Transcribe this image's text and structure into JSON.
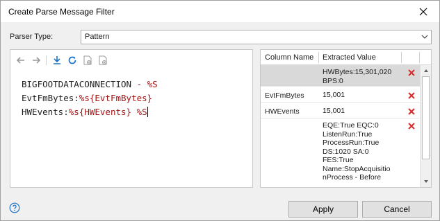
{
  "window": {
    "title": "Create Parse Message Filter"
  },
  "parser": {
    "label": "Parser Type:",
    "value": "Pattern"
  },
  "editor": {
    "lines": [
      [
        {
          "t": "BIGFOOTDATACONNECTION ",
          "c": "plain"
        },
        {
          "t": "-",
          "c": "dash"
        },
        {
          "t": " %S",
          "c": "var"
        }
      ],
      [
        {
          "t": "EvtFmBytes:",
          "c": "plain"
        },
        {
          "t": "%s",
          "c": "var"
        },
        {
          "t": "{EvtFmBytes}",
          "c": "var"
        }
      ],
      [
        {
          "t": "HWEvents:",
          "c": "plain"
        },
        {
          "t": "%s",
          "c": "var"
        },
        {
          "t": "{HWEvents} ",
          "c": "var"
        },
        {
          "t": "%S",
          "c": "var"
        }
      ]
    ],
    "toolbar": [
      "undo-icon",
      "redo-icon",
      "download-icon",
      "refresh-icon",
      "add-file-icon",
      "remove-file-icon"
    ]
  },
  "grid": {
    "columns": [
      "Column Name",
      "Extracted Value"
    ],
    "rows": [
      {
        "name": "",
        "value": "HWBytes:15,301,020\nBPS:0",
        "selected": true
      },
      {
        "name": "EvtFmBytes",
        "value": "15,001",
        "selected": false
      },
      {
        "name": "HWEvents",
        "value": "15,001",
        "selected": false
      },
      {
        "name": "",
        "value": "EQE:True EQC:0\nListenRun:True\nProcessRun:True\nDS:1020 SA:0\nFES:True\nName:StopAcquisitio\nnProcess - Before",
        "selected": false
      }
    ]
  },
  "buttons": {
    "apply": "Apply",
    "cancel": "Cancel"
  },
  "colors": {
    "delete_red": "#d92b2b",
    "toolbar_blue": "#1a73c8",
    "syntax_red": "#a31515"
  }
}
